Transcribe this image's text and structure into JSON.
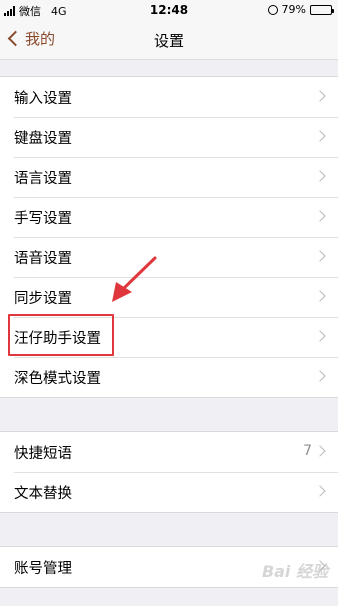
{
  "status_bar": {
    "carrier": "微信",
    "network": "4G",
    "time": "12:48",
    "battery_percent": "79%",
    "battery_level": 0.79
  },
  "nav": {
    "back_label": "我的",
    "title": "设置"
  },
  "group1": {
    "items": [
      {
        "label": "输入设置"
      },
      {
        "label": "键盘设置"
      },
      {
        "label": "语言设置"
      },
      {
        "label": "手写设置"
      },
      {
        "label": "语音设置"
      },
      {
        "label": "同步设置"
      },
      {
        "label": "汪仔助手设置"
      },
      {
        "label": "深色模式设置"
      }
    ]
  },
  "group2": {
    "items": [
      {
        "label": "快捷短语",
        "value": "7"
      },
      {
        "label": "文本替换"
      }
    ]
  },
  "group3": {
    "items": [
      {
        "label": "账号管理"
      }
    ]
  },
  "colors": {
    "accent": "#8a4b2d",
    "annotation": "#e0373c",
    "background": "#efeff4"
  },
  "watermark": "Bai 经验"
}
